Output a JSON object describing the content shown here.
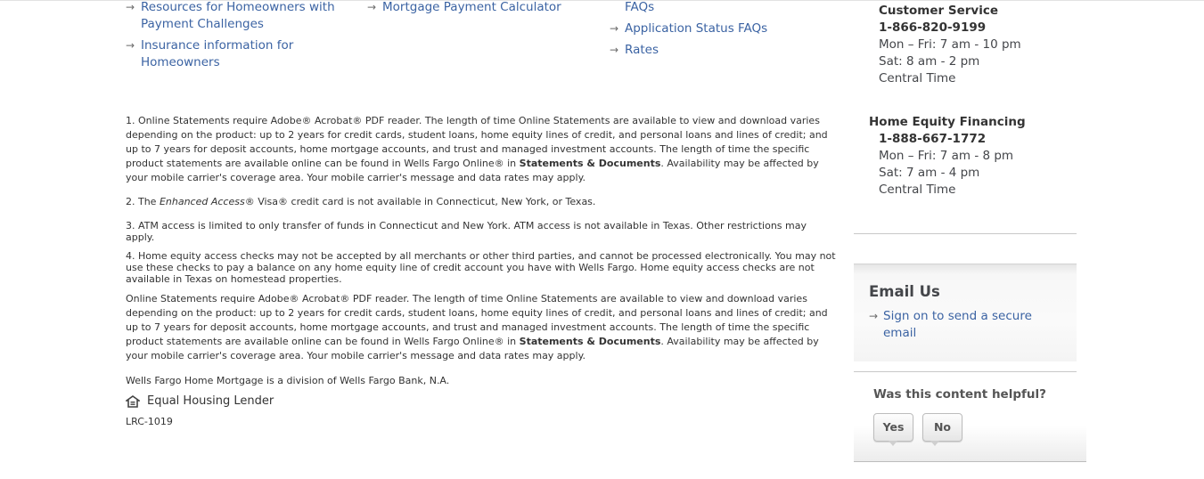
{
  "links": {
    "col1": [
      {
        "line1": "Resources for Homeowners with",
        "line2": "Payment Challenges"
      },
      {
        "line1": "Insurance information for",
        "line2": "Homeowners"
      }
    ],
    "col2": [
      {
        "line1": "Mortgage Payment Calculator"
      }
    ],
    "col3": [
      {
        "line1": "FAQs"
      },
      {
        "line1": "Application Status FAQs"
      },
      {
        "line1": "Rates"
      }
    ]
  },
  "footnotes": {
    "fn1": {
      "prefix": "1. Online Statements require Adobe® Acrobat® PDF reader. The length of time Online Statements are available to view and download varies depending on the product: up to 2 years for credit cards, student loans, home equity lines of credit, and personal loans and lines of credit; and up to 7 years for deposit accounts, home mortgage accounts, and trust and managed investment accounts. The length of time the specific product statements are available online can be found in Wells Fargo Online® in ",
      "bold": "Statements & Documents",
      "suffix": ". Availability may be affected by your mobile carrier's coverage area. Your mobile carrier's message and data rates may apply."
    },
    "fn2": {
      "prefix": "2. The ",
      "italic": "Enhanced Access",
      "suffix": "® Visa® credit card is not available in Connecticut, New York, or Texas."
    },
    "fn3": "3. ATM access is limited to only transfer of funds in Connecticut and New York. ATM access is not available in Texas. Other restrictions may apply.",
    "fn4": "4. Home equity access checks may not be accepted by all merchants or other third parties, and cannot be processed electronically. You may not use these checks to pay a balance on any home equity line of credit account you have with Wells Fargo. Home equity access checks are not available in Texas on homestead properties.",
    "fn5": {
      "prefix": "Online Statements require Adobe® Acrobat® PDF reader. The length of time Online Statements are available to view and download varies depending on the product: up to 2 years for credit cards, student loans, home equity lines of credit, and personal loans and lines of credit; and up to 7 years for deposit accounts, home mortgage accounts, and trust and managed investment accounts. The length of time the specific product statements are available online can be found in Wells Fargo Online® in ",
      "bold": "Statements & Documents",
      "suffix": ". Availability may be affected by your mobile carrier's coverage area. Your mobile carrier's message and data rates may apply."
    },
    "division": "Wells Fargo Home Mortgage is a division of Wells Fargo Bank, N.A.",
    "ehl": "Equal Housing Lender",
    "code": "LRC-1019"
  },
  "sidebar": {
    "customer_service": {
      "title": "Customer Service",
      "phone": "1-866-820-9199",
      "hours1": "Mon – Fri: 7 am - 10 pm",
      "hours2": "Sat: 8 am - 2 pm",
      "tz": "Central Time"
    },
    "home_equity": {
      "title": "Home Equity Financing",
      "phone": "1-888-667-1772",
      "hours1": "Mon – Fri: 7 am - 8 pm",
      "hours2": "Sat: 7 am - 4 pm",
      "tz": "Central Time"
    },
    "email": {
      "title": "Email Us",
      "link_line1": "Sign on to send a secure",
      "link_line2": "email"
    },
    "helpful": {
      "title": "Was this content helpful?",
      "yes": "Yes",
      "no": "No"
    }
  },
  "colors": {
    "link": "#3b63a3",
    "text": "#44464a"
  },
  "icons": {
    "arrow": "arrow-right-icon",
    "house": "equal-housing-icon"
  }
}
